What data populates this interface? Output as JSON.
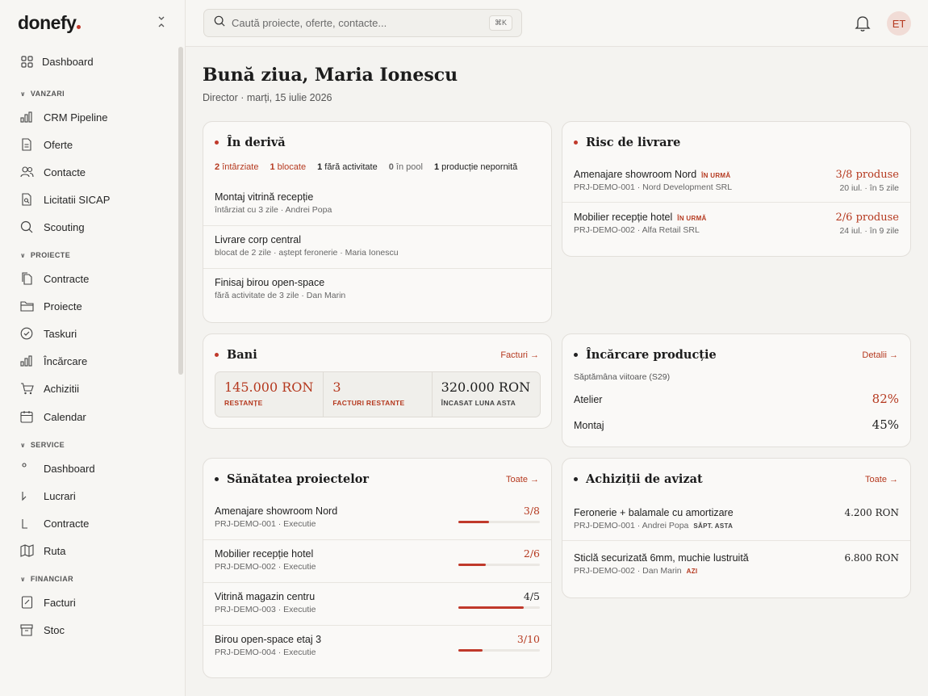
{
  "app": {
    "logo": "donefy"
  },
  "sidebar": {
    "dashboard": "Dashboard",
    "sections": [
      {
        "label": "VANZARI",
        "items": [
          "CRM Pipeline",
          "Oferte",
          "Contacte",
          "Licitatii SICAP",
          "Scouting"
        ]
      },
      {
        "label": "PROIECTE",
        "items": [
          "Contracte",
          "Proiecte",
          "Taskuri",
          "Încărcare",
          "Achizitii",
          "Calendar"
        ]
      },
      {
        "label": "SERVICE",
        "items": [
          "Dashboard",
          "Lucrari",
          "Contracte",
          "Ruta"
        ]
      },
      {
        "label": "FINANCIAR",
        "items": [
          "Facturi",
          "Stoc"
        ]
      }
    ]
  },
  "topbar": {
    "search_placeholder": "Caută proiecte, oferte, contacte...",
    "shortcut": "⌘K",
    "avatar_initials": "ET"
  },
  "greeting": {
    "title": "Bună ziua, Maria Ionescu",
    "subtitle": "Director · marți, 15 iulie 2026"
  },
  "drift": {
    "title": "În derivă",
    "stats": [
      {
        "num": "2",
        "label": "întârziate"
      },
      {
        "num": "1",
        "label": "blocate"
      },
      {
        "num": "1",
        "label": "fără activitate"
      },
      {
        "num": "0",
        "label": "în pool"
      },
      {
        "num": "1",
        "label": "producție nepornită"
      }
    ],
    "items": [
      {
        "title": "Montaj vitrină recepție",
        "sub": "întârziat cu 3 zile · Andrei Popa"
      },
      {
        "title": "Livrare corp central",
        "sub": "blocat de 2 zile · aștept feronerie · Maria Ionescu"
      },
      {
        "title": "Finisaj birou open-space",
        "sub": "fără activitate de 3 zile · Dan Marin"
      }
    ]
  },
  "risk": {
    "title": "Risc de livrare",
    "items": [
      {
        "title": "Amenajare showroom Nord",
        "badge": "ÎN URMĂ",
        "sub": "PRJ-DEMO-001 · Nord Development SRL",
        "value": "3/8 produse",
        "date": "20 iul. · în 5 zile"
      },
      {
        "title": "Mobilier recepție hotel",
        "badge": "ÎN URMĂ",
        "sub": "PRJ-DEMO-002 · Alfa Retail SRL",
        "value": "2/6 produse",
        "date": "24 iul. · în 9 zile"
      }
    ]
  },
  "money": {
    "title": "Bani",
    "link": "Facturi →",
    "cells": [
      {
        "value": "145.000 RON",
        "label": "RESTANȚE"
      },
      {
        "value": "3",
        "label": "FACTURI RESTANTE"
      },
      {
        "value": "320.000 RON",
        "label": "ÎNCASAT LUNA ASTA"
      }
    ]
  },
  "production": {
    "title": "Încărcare producție",
    "link": "Detalii →",
    "period": "Săptămâna viitoare (S29)",
    "rows": [
      {
        "label": "Atelier",
        "value": "82%"
      },
      {
        "label": "Montaj",
        "value": "45%"
      }
    ]
  },
  "health": {
    "title": "Sănătatea proiectelor",
    "link": "Toate →",
    "items": [
      {
        "title": "Amenajare showroom Nord",
        "sub": "PRJ-DEMO-001 · Executie",
        "progress": "3/8",
        "fraction": 0.375
      },
      {
        "title": "Mobilier recepție hotel",
        "sub": "PRJ-DEMO-002 · Executie",
        "progress": "2/6",
        "fraction": 0.333
      },
      {
        "title": "Vitrină magazin centru",
        "sub": "PRJ-DEMO-003 · Executie",
        "progress": "4/5",
        "fraction": 0.8
      },
      {
        "title": "Birou open-space etaj 3",
        "sub": "PRJ-DEMO-004 · Executie",
        "progress": "3/10",
        "fraction": 0.3
      }
    ]
  },
  "purchases": {
    "title": "Achiziții de avizat",
    "link": "Toate →",
    "items": [
      {
        "title": "Feronerie + balamale cu amortizare",
        "sub": "PRJ-DEMO-001 · Andrei Popa",
        "badge": "SĂPT. ASTA",
        "value": "4.200 RON"
      },
      {
        "title": "Sticlă securizată 6mm, muchie lustruită",
        "sub": "PRJ-DEMO-002 · Dan Marin",
        "badge": "AZI",
        "value": "6.800 RON"
      }
    ]
  }
}
